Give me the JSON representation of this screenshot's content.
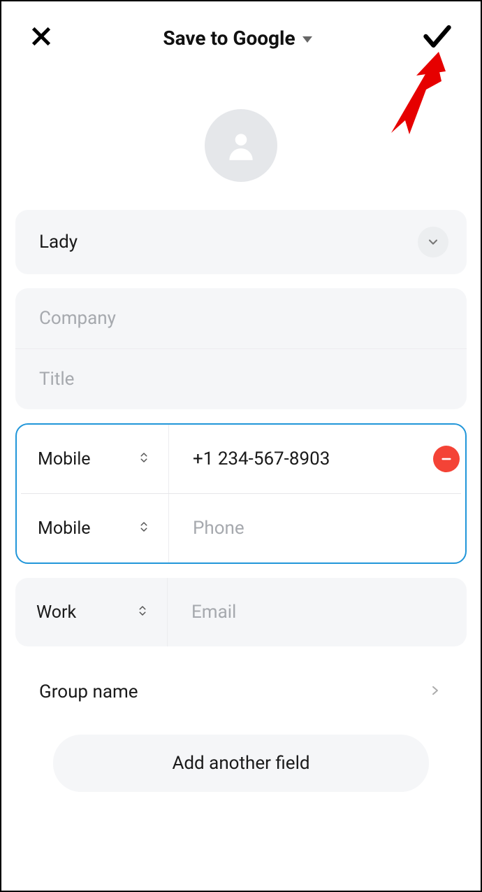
{
  "header": {
    "title": "Save to Google"
  },
  "contact": {
    "name": "Lady"
  },
  "placeholders": {
    "company": "Company",
    "title": "Title",
    "phone": "Phone",
    "email": "Email"
  },
  "phone_entries": [
    {
      "type": "Mobile",
      "value": "+1 234-567-8903"
    },
    {
      "type": "Mobile",
      "value": ""
    }
  ],
  "email_entries": [
    {
      "type": "Work",
      "value": ""
    }
  ],
  "labels": {
    "group": "Group name",
    "add_field": "Add another field"
  }
}
